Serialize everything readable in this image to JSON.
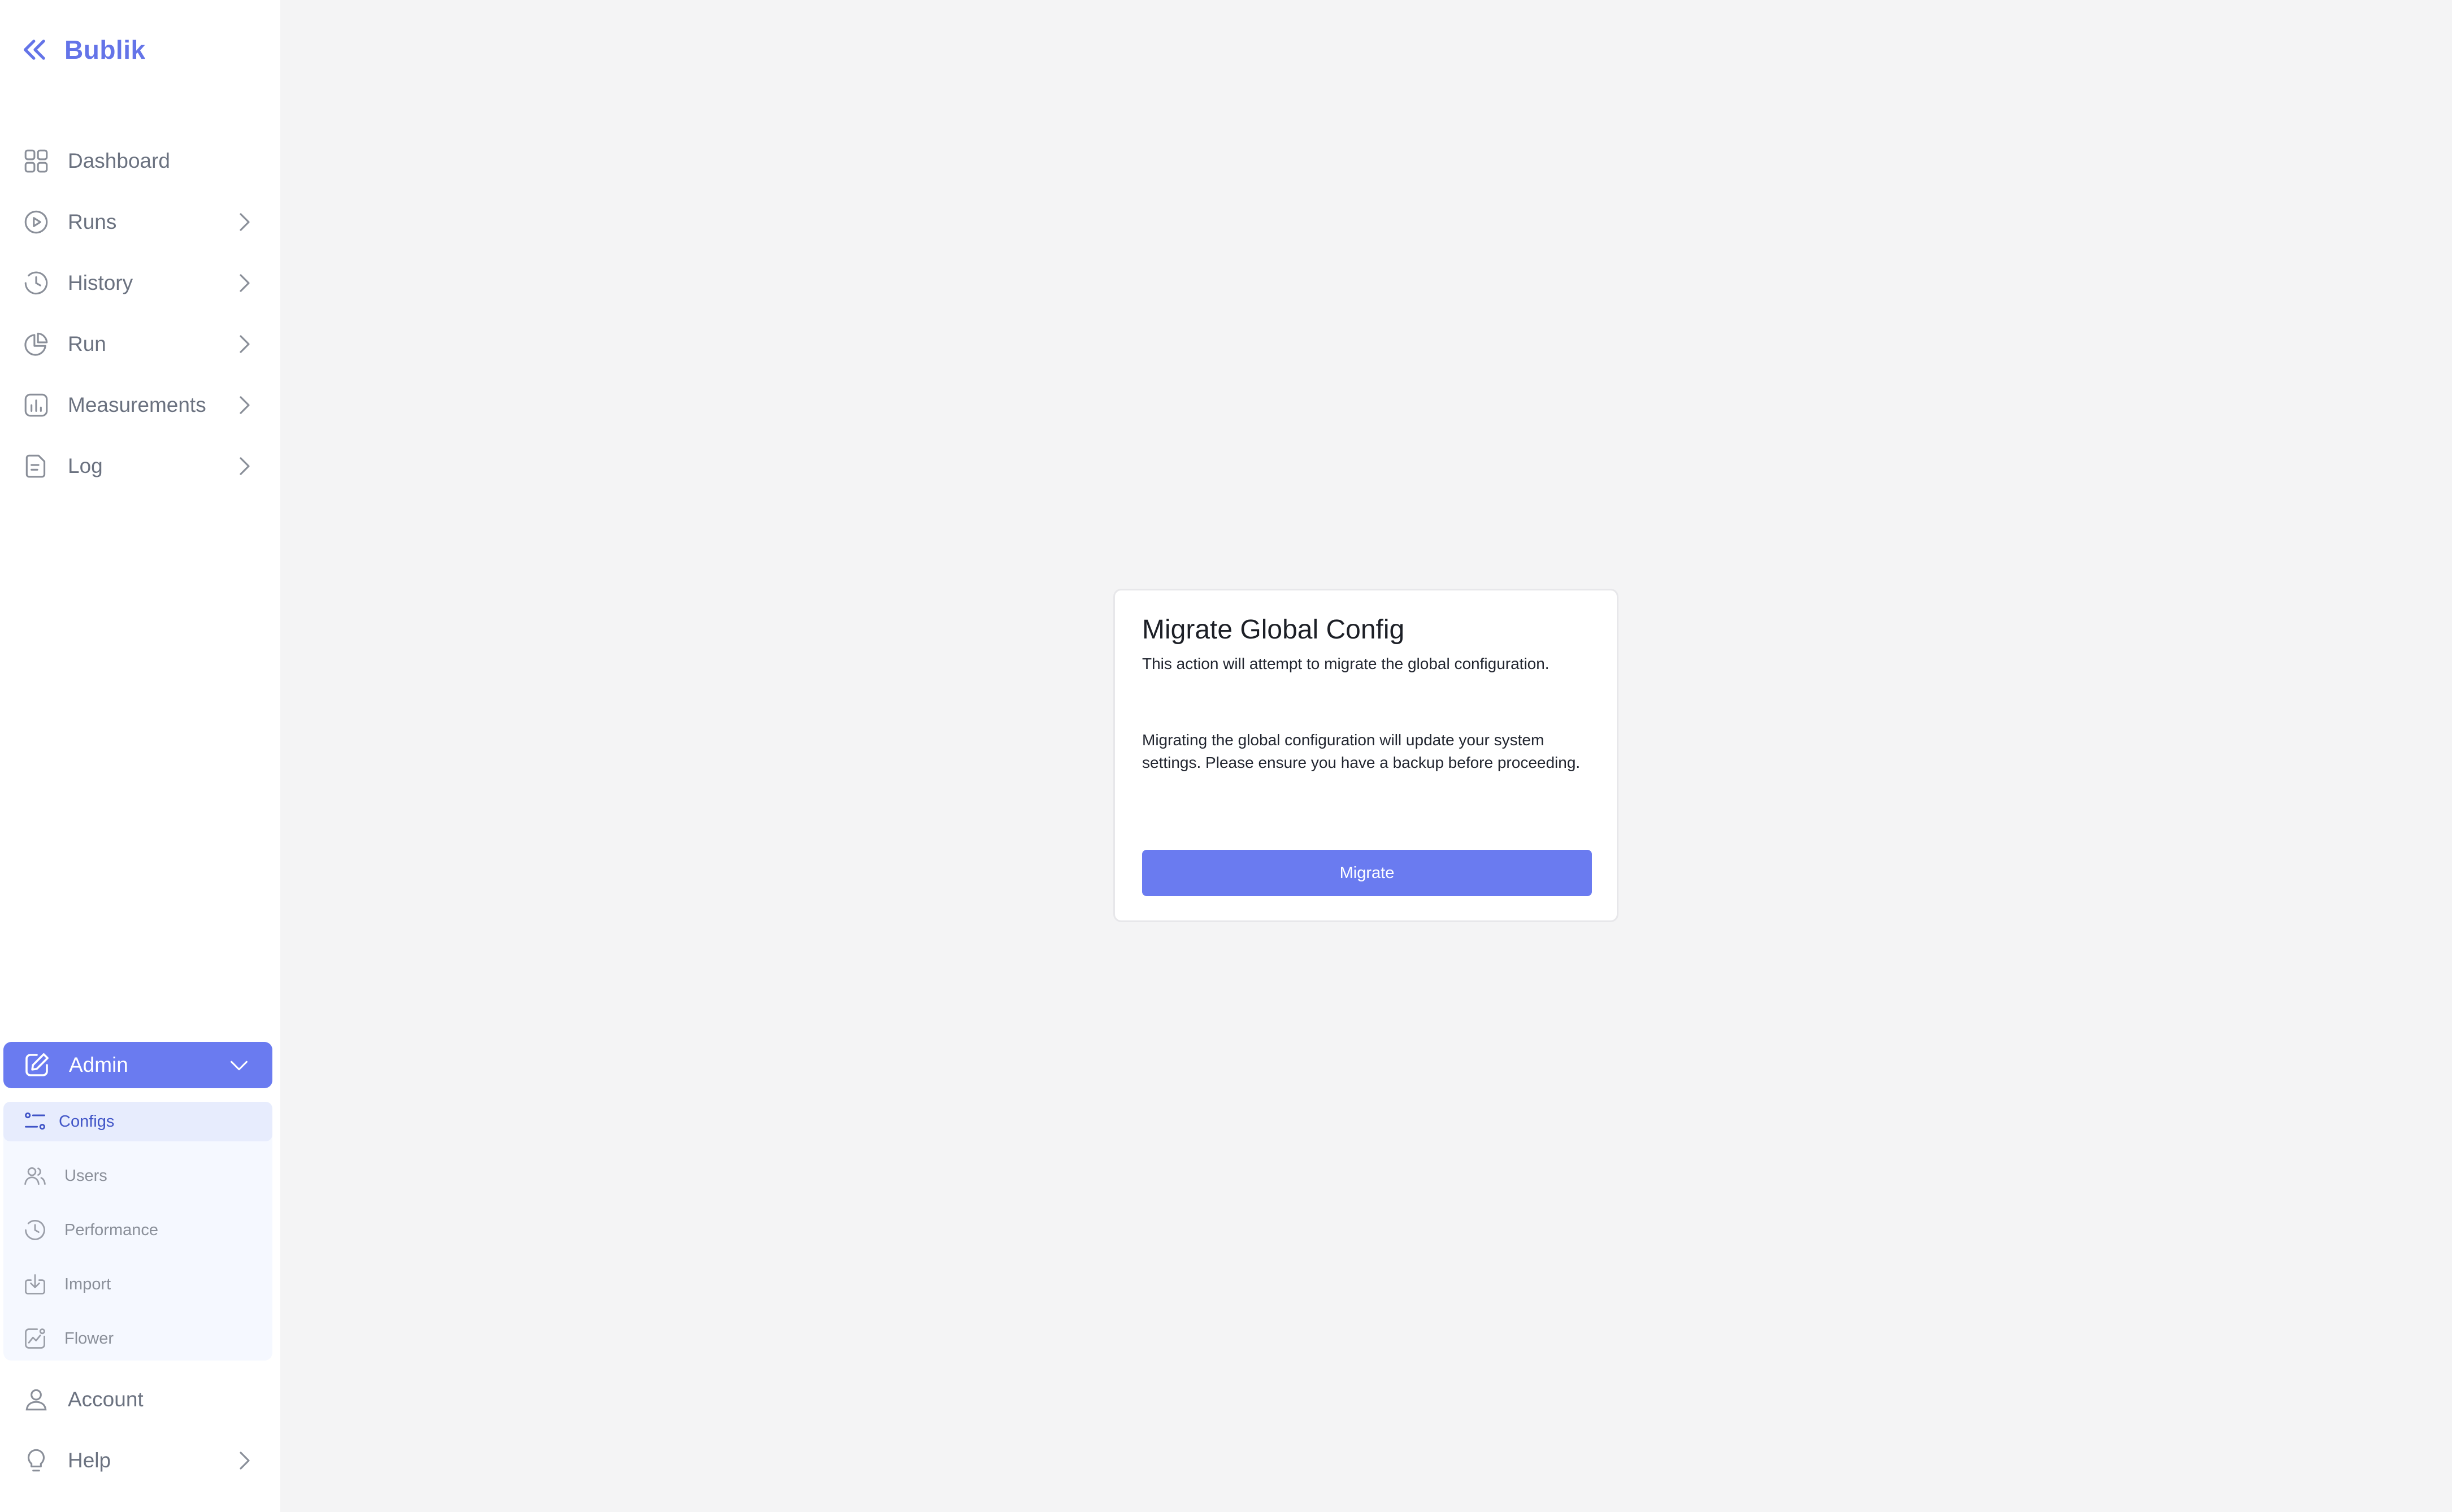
{
  "brand": {
    "name": "Bublik",
    "icon": "double-chevron-left-icon"
  },
  "nav": [
    {
      "key": "dashboard",
      "label": "Dashboard",
      "icon": "grid-icon",
      "has_chevron": false
    },
    {
      "key": "runs",
      "label": "Runs",
      "icon": "play-circle-icon",
      "has_chevron": true
    },
    {
      "key": "history",
      "label": "History",
      "icon": "clock-icon",
      "has_chevron": true
    },
    {
      "key": "run",
      "label": "Run",
      "icon": "pie-chart-icon",
      "has_chevron": true
    },
    {
      "key": "measurements",
      "label": "Measurements",
      "icon": "bar-chart-icon",
      "has_chevron": true
    },
    {
      "key": "log",
      "label": "Log",
      "icon": "document-icon",
      "has_chevron": true
    }
  ],
  "admin": {
    "label": "Admin",
    "icon": "edit-icon",
    "expanded": true,
    "items": [
      {
        "label": "Configs",
        "icon": "sliders-icon",
        "active": true
      },
      {
        "label": "Users",
        "icon": "users-icon",
        "active": false
      },
      {
        "label": "Performance",
        "icon": "clock-icon",
        "active": false
      },
      {
        "label": "Import",
        "icon": "import-icon",
        "active": false
      },
      {
        "label": "Flower",
        "icon": "chart-icon",
        "active": false
      }
    ]
  },
  "bottom_nav": [
    {
      "label": "Account",
      "icon": "user-icon",
      "has_chevron": false
    },
    {
      "label": "Help",
      "icon": "lightbulb-icon",
      "has_chevron": true
    }
  ],
  "dialog": {
    "title": "Migrate Global Config",
    "description": "This action will attempt to migrate the global configuration.",
    "body": "Migrating the global configuration will update your system settings. Please ensure you have a backup before proceeding.",
    "button_label": "Migrate"
  },
  "colors": {
    "accent": "#6a7bf0",
    "brand_text": "#6474e8",
    "background": "#f4f4f5",
    "nav_text": "#6b7280",
    "active_sub_bg": "#e7ecfd"
  }
}
